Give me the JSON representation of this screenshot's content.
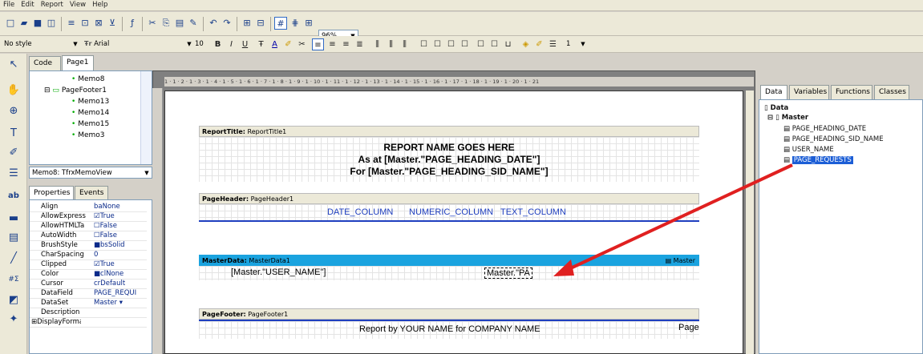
{
  "menu": [
    "File",
    "Edit",
    "Report",
    "View",
    "Help"
  ],
  "toolbar": {
    "zoom": "96%",
    "style": "No style",
    "font": "Arial",
    "size": "10",
    "frame_width": "1"
  },
  "tabs": {
    "code": "Code",
    "page1": "Page1"
  },
  "tree": [
    {
      "label": "Memo8"
    },
    {
      "label": "PageFooter1"
    },
    {
      "label": "Memo13"
    },
    {
      "label": "Memo14"
    },
    {
      "label": "Memo15"
    },
    {
      "label": "Memo3"
    }
  ],
  "object_combo": "Memo8: TfrxMemoView",
  "prop_tabs": {
    "props": "Properties",
    "events": "Events"
  },
  "properties": [
    {
      "name": "Align",
      "value": "baNone"
    },
    {
      "name": "AllowExpress",
      "value": "True"
    },
    {
      "name": "AllowHTMLTa",
      "value": "False"
    },
    {
      "name": "AutoWidth",
      "value": "False"
    },
    {
      "name": "BrushStyle",
      "value": "bsSolid"
    },
    {
      "name": "CharSpacing",
      "value": "0"
    },
    {
      "name": "Clipped",
      "value": "True"
    },
    {
      "name": "Color",
      "value": "clNone"
    },
    {
      "name": "Cursor",
      "value": "crDefault"
    },
    {
      "name": "DataField",
      "value": "PAGE_REQUI"
    },
    {
      "name": "DataSet",
      "value": "Master"
    },
    {
      "name": "Description",
      "value": ""
    },
    {
      "name": "DisplayForma",
      "value": ""
    }
  ],
  "ruler": "1 · 1 · 2 · 1 · 3 · 1 · 4 · 1 · 5 · 1 · 6 · 1 · 7 · 1 · 8 · 1 · 9 · 1 · 10 · 1 · 11 · 1 · 12 · 1 · 13 · 1 · 14 · 1 · 15 · 1 · 16 · 1 · 17 · 1 · 18 · 1 · 19 · 1 · 20 · 1 · 21",
  "bands": {
    "title": {
      "type": "ReportTitle:",
      "name": "ReportTitle1",
      "line1": "REPORT NAME GOES HERE",
      "line2": "As at [Master.\"PAGE_HEADING_DATE\"]",
      "line3": "For [Master.\"PAGE_HEADING_SID_NAME\"]"
    },
    "header": {
      "type": "PageHeader:",
      "name": "PageHeader1",
      "col1": "DATE_COLUMN",
      "col2": "NUMERIC_COLUMN",
      "col3": "TEXT_COLUMN"
    },
    "master": {
      "type": "MasterData:",
      "name": "MasterData1",
      "tag": "Master",
      "memo1": "[Master.\"USER_NAME\"]",
      "memo2": "Master.\"PA"
    },
    "footer": {
      "type": "PageFooter:",
      "name": "PageFooter1",
      "memo": "Report by YOUR NAME for COMPANY NAME",
      "page": "Page"
    }
  },
  "right_tabs": [
    "Data",
    "Variables",
    "Functions",
    "Classes"
  ],
  "data_tree": {
    "root": "Data",
    "dataset": "Master",
    "fields": [
      "PAGE_HEADING_DATE",
      "PAGE_HEADING_SID_NAME",
      "USER_NAME",
      "PAGE_REQUESTS"
    ]
  },
  "colors": {
    "master_band": "#1aa3df",
    "arrow": "#e02020",
    "selection": "#1c5ed6"
  }
}
